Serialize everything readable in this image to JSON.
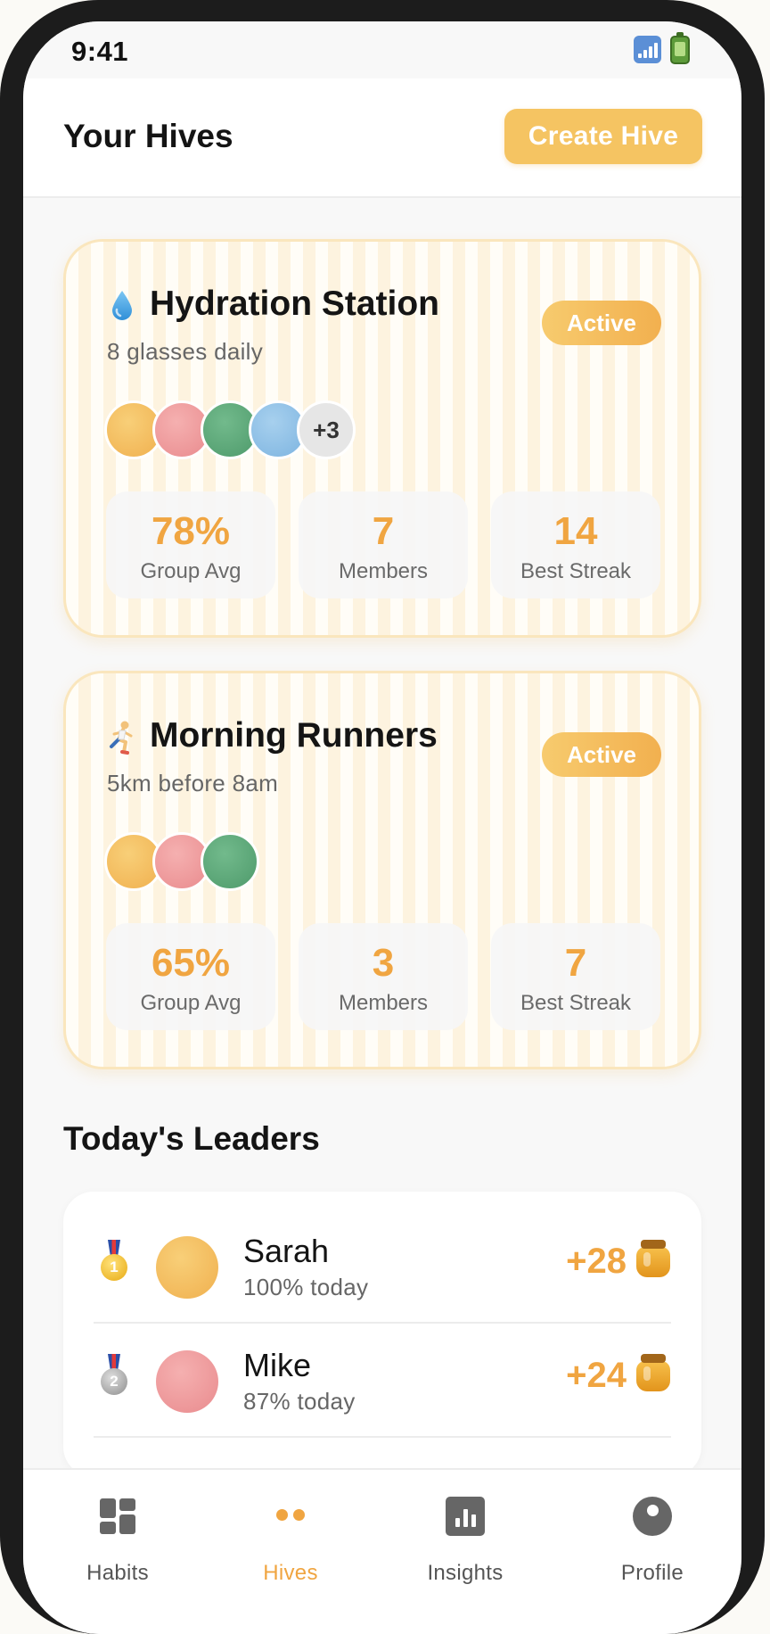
{
  "status_bar": {
    "time": "9:41",
    "icons": [
      "signal-icon",
      "battery-icon"
    ]
  },
  "header": {
    "title": "Your Hives",
    "create_button": "Create Hive"
  },
  "hives": [
    {
      "icon": "💧",
      "icon_name": "water-drop-icon",
      "name": "Hydration Station",
      "goal": "8 glasses daily",
      "status": "Active",
      "avatar_colors": [
        "#f3be60",
        "#ef9ea0",
        "#5ca97a",
        "#8fc1e6"
      ],
      "extra_members": "+3",
      "stats": [
        {
          "value": "78%",
          "label": "Group Avg"
        },
        {
          "value": "7",
          "label": "Members"
        },
        {
          "value": "14",
          "label": "Best Streak"
        }
      ]
    },
    {
      "icon": "🏃",
      "icon_name": "runner-icon",
      "name": "Morning Runners",
      "goal": "5km before 8am",
      "status": "Active",
      "avatar_colors": [
        "#f3be60",
        "#ef9ea0",
        "#5ca97a"
      ],
      "extra_members": "",
      "stats": [
        {
          "value": "65%",
          "label": "Group Avg"
        },
        {
          "value": "3",
          "label": "Members"
        },
        {
          "value": "7",
          "label": "Best Streak"
        }
      ]
    }
  ],
  "leaders": {
    "title": "Today's Leaders",
    "entries": [
      {
        "rank": "1",
        "medal": "gold-medal-icon",
        "name": "Sarah",
        "progress": "100% today",
        "points": "+28",
        "avatar_color": "#f3be60"
      },
      {
        "rank": "2",
        "medal": "silver-medal-icon",
        "name": "Mike",
        "progress": "87% today",
        "points": "+24",
        "avatar_color": "#ef9ea0"
      }
    ]
  },
  "nav": {
    "items": [
      {
        "label": "Habits",
        "icon": "dashboard-grid-icon",
        "active": false
      },
      {
        "label": "Hives",
        "icon": "two-dots-icon",
        "active": true
      },
      {
        "label": "Insights",
        "icon": "bar-chart-icon",
        "active": false
      },
      {
        "label": "Profile",
        "icon": "profile-icon",
        "active": false
      }
    ]
  },
  "colors": {
    "accent": "#f0a541",
    "accent_light": "#f5c462",
    "card_border": "#fae6bd"
  }
}
